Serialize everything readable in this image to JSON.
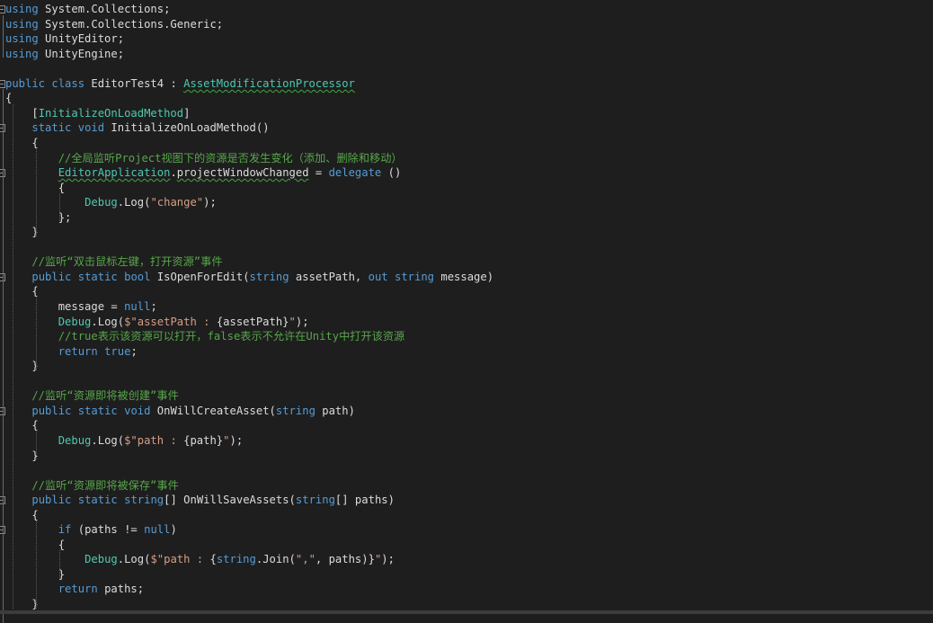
{
  "editor": {
    "language": "C#",
    "lines": [
      {
        "fold": "region",
        "tokens": [
          {
            "t": "using",
            "k": "kw"
          },
          {
            "t": " System.Collections;",
            "k": "id"
          }
        ]
      },
      {
        "fold": "",
        "tokens": [
          {
            "t": "using",
            "k": "kw"
          },
          {
            "t": " System.Collections.Generic;",
            "k": "id"
          }
        ]
      },
      {
        "fold": "",
        "tokens": [
          {
            "t": "using",
            "k": "kw"
          },
          {
            "t": " UnityEditor;",
            "k": "id"
          }
        ]
      },
      {
        "fold": "",
        "tokens": [
          {
            "t": "using",
            "k": "kw"
          },
          {
            "t": " UnityEngine;",
            "k": "id"
          }
        ]
      },
      {
        "fold": "",
        "tokens": []
      },
      {
        "fold": "open",
        "tokens": [
          {
            "t": "public",
            "k": "kw"
          },
          {
            "t": " ",
            "k": "id"
          },
          {
            "t": "class",
            "k": "kw"
          },
          {
            "t": " EditorTest4 : ",
            "k": "id"
          },
          {
            "t": "AssetModificationProcessor",
            "k": "squig-ty"
          }
        ]
      },
      {
        "fold": "",
        "tokens": [
          {
            "t": "{",
            "k": "id"
          }
        ]
      },
      {
        "fold": "",
        "tokens": [
          {
            "t": "    [",
            "k": "id"
          },
          {
            "t": "InitializeOnLoadMethod",
            "k": "ty"
          },
          {
            "t": "]",
            "k": "id"
          }
        ]
      },
      {
        "fold": "open",
        "tokens": [
          {
            "t": "    ",
            "k": "id"
          },
          {
            "t": "static",
            "k": "kw"
          },
          {
            "t": " ",
            "k": "id"
          },
          {
            "t": "void",
            "k": "kw"
          },
          {
            "t": " InitializeOnLoadMethod()",
            "k": "id"
          }
        ]
      },
      {
        "fold": "",
        "tokens": [
          {
            "t": "    {",
            "k": "id"
          }
        ]
      },
      {
        "fold": "",
        "tokens": [
          {
            "t": "        //全局监听Project视图下的资源是否发生变化（添加、删除和移动）",
            "k": "cm"
          }
        ]
      },
      {
        "fold": "open",
        "tokens": [
          {
            "t": "        ",
            "k": "id"
          },
          {
            "t": "EditorApplication",
            "k": "squig-ty"
          },
          {
            "t": ".",
            "k": "id"
          },
          {
            "t": "projectWindowChanged",
            "k": "squig"
          },
          {
            "t": " = ",
            "k": "id"
          },
          {
            "t": "delegate",
            "k": "kw"
          },
          {
            "t": " ()",
            "k": "id"
          }
        ]
      },
      {
        "fold": "",
        "tokens": [
          {
            "t": "        {",
            "k": "id"
          }
        ]
      },
      {
        "fold": "",
        "tokens": [
          {
            "t": "            ",
            "k": "id"
          },
          {
            "t": "Debug",
            "k": "ty"
          },
          {
            "t": ".Log(",
            "k": "id"
          },
          {
            "t": "\"change\"",
            "k": "st"
          },
          {
            "t": ");",
            "k": "id"
          }
        ]
      },
      {
        "fold": "",
        "tokens": [
          {
            "t": "        };",
            "k": "id"
          }
        ]
      },
      {
        "fold": "",
        "tokens": [
          {
            "t": "    }",
            "k": "id"
          }
        ]
      },
      {
        "fold": "",
        "tokens": []
      },
      {
        "fold": "",
        "tokens": [
          {
            "t": "    //监听“双击鼠标左键，打开资源”事件",
            "k": "cm"
          }
        ]
      },
      {
        "fold": "open",
        "tokens": [
          {
            "t": "    ",
            "k": "id"
          },
          {
            "t": "public",
            "k": "kw"
          },
          {
            "t": " ",
            "k": "id"
          },
          {
            "t": "static",
            "k": "kw"
          },
          {
            "t": " ",
            "k": "id"
          },
          {
            "t": "bool",
            "k": "kw"
          },
          {
            "t": " IsOpenForEdit(",
            "k": "id"
          },
          {
            "t": "string",
            "k": "kw"
          },
          {
            "t": " assetPath, ",
            "k": "id"
          },
          {
            "t": "out",
            "k": "kw"
          },
          {
            "t": " ",
            "k": "id"
          },
          {
            "t": "string",
            "k": "kw"
          },
          {
            "t": " message)",
            "k": "id"
          }
        ]
      },
      {
        "fold": "",
        "tokens": [
          {
            "t": "    {",
            "k": "id"
          }
        ]
      },
      {
        "fold": "",
        "tokens": [
          {
            "t": "        message = ",
            "k": "id"
          },
          {
            "t": "null",
            "k": "kw"
          },
          {
            "t": ";",
            "k": "id"
          }
        ]
      },
      {
        "fold": "",
        "tokens": [
          {
            "t": "        ",
            "k": "id"
          },
          {
            "t": "Debug",
            "k": "ty"
          },
          {
            "t": ".Log(",
            "k": "id"
          },
          {
            "t": "$\"assetPath : ",
            "k": "st"
          },
          {
            "t": "{assetPath}",
            "k": "id"
          },
          {
            "t": "\"",
            "k": "st"
          },
          {
            "t": ");",
            "k": "id"
          }
        ]
      },
      {
        "fold": "",
        "tokens": [
          {
            "t": "        //true表示该资源可以打开，false表示不允许在Unity中打开该资源",
            "k": "cm"
          }
        ]
      },
      {
        "fold": "",
        "tokens": [
          {
            "t": "        ",
            "k": "id"
          },
          {
            "t": "return",
            "k": "kw"
          },
          {
            "t": " ",
            "k": "id"
          },
          {
            "t": "true",
            "k": "kw"
          },
          {
            "t": ";",
            "k": "id"
          }
        ]
      },
      {
        "fold": "",
        "tokens": [
          {
            "t": "    }",
            "k": "id"
          }
        ]
      },
      {
        "fold": "",
        "tokens": []
      },
      {
        "fold": "",
        "tokens": [
          {
            "t": "    //监听“资源即将被创建”事件",
            "k": "cm"
          }
        ]
      },
      {
        "fold": "open",
        "tokens": [
          {
            "t": "    ",
            "k": "id"
          },
          {
            "t": "public",
            "k": "kw"
          },
          {
            "t": " ",
            "k": "id"
          },
          {
            "t": "static",
            "k": "kw"
          },
          {
            "t": " ",
            "k": "id"
          },
          {
            "t": "void",
            "k": "kw"
          },
          {
            "t": " OnWillCreateAsset(",
            "k": "id"
          },
          {
            "t": "string",
            "k": "kw"
          },
          {
            "t": " path)",
            "k": "id"
          }
        ]
      },
      {
        "fold": "",
        "tokens": [
          {
            "t": "    {",
            "k": "id"
          }
        ]
      },
      {
        "fold": "",
        "tokens": [
          {
            "t": "        ",
            "k": "id"
          },
          {
            "t": "Debug",
            "k": "ty"
          },
          {
            "t": ".Log(",
            "k": "id"
          },
          {
            "t": "$\"path : ",
            "k": "st"
          },
          {
            "t": "{path}",
            "k": "id"
          },
          {
            "t": "\"",
            "k": "st"
          },
          {
            "t": ");",
            "k": "id"
          }
        ]
      },
      {
        "fold": "",
        "tokens": [
          {
            "t": "    }",
            "k": "id"
          }
        ]
      },
      {
        "fold": "",
        "tokens": []
      },
      {
        "fold": "",
        "tokens": [
          {
            "t": "    //监听“资源即将被保存”事件",
            "k": "cm"
          }
        ]
      },
      {
        "fold": "open",
        "tokens": [
          {
            "t": "    ",
            "k": "id"
          },
          {
            "t": "public",
            "k": "kw"
          },
          {
            "t": " ",
            "k": "id"
          },
          {
            "t": "static",
            "k": "kw"
          },
          {
            "t": " ",
            "k": "id"
          },
          {
            "t": "string",
            "k": "kw"
          },
          {
            "t": "[] OnWillSaveAssets(",
            "k": "id"
          },
          {
            "t": "string",
            "k": "kw"
          },
          {
            "t": "[] paths)",
            "k": "id"
          }
        ]
      },
      {
        "fold": "",
        "tokens": [
          {
            "t": "    {",
            "k": "id"
          }
        ]
      },
      {
        "fold": "open",
        "tokens": [
          {
            "t": "        ",
            "k": "id"
          },
          {
            "t": "if",
            "k": "kw"
          },
          {
            "t": " (paths != ",
            "k": "id"
          },
          {
            "t": "null",
            "k": "kw"
          },
          {
            "t": ")",
            "k": "id"
          }
        ]
      },
      {
        "fold": "",
        "tokens": [
          {
            "t": "        {",
            "k": "id"
          }
        ]
      },
      {
        "fold": "",
        "tokens": [
          {
            "t": "            ",
            "k": "id"
          },
          {
            "t": "Debug",
            "k": "ty"
          },
          {
            "t": ".Log(",
            "k": "id"
          },
          {
            "t": "$\"path : ",
            "k": "st"
          },
          {
            "t": "{",
            "k": "id"
          },
          {
            "t": "string",
            "k": "kw"
          },
          {
            "t": ".Join(",
            "k": "id"
          },
          {
            "t": "\",\"",
            "k": "st"
          },
          {
            "t": ", paths)}",
            "k": "id"
          },
          {
            "t": "\"",
            "k": "st"
          },
          {
            "t": ");",
            "k": "id"
          }
        ]
      },
      {
        "fold": "",
        "tokens": [
          {
            "t": "        }",
            "k": "id"
          }
        ]
      },
      {
        "fold": "",
        "tokens": [
          {
            "t": "        ",
            "k": "id"
          },
          {
            "t": "return",
            "k": "kw"
          },
          {
            "t": " paths;",
            "k": "id"
          }
        ]
      },
      {
        "fold": "",
        "tokens": [
          {
            "t": "    }",
            "k": "id"
          }
        ]
      }
    ]
  }
}
